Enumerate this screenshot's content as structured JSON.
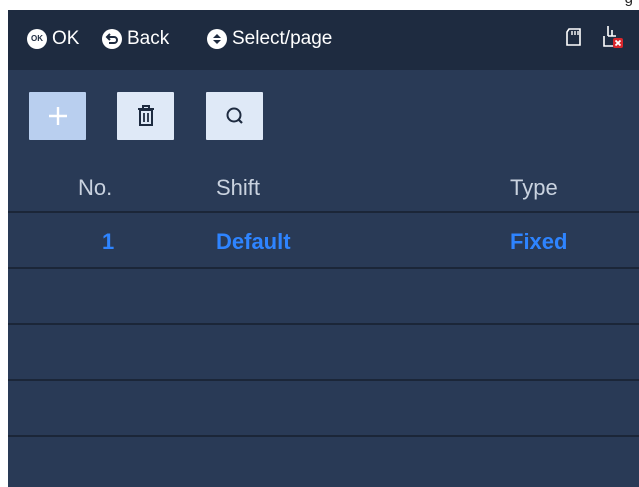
{
  "page_fragment": "g",
  "status": {
    "ok_label": "OK",
    "back_label": "Back",
    "select_label": "Select/page",
    "icons": [
      "ok-icon",
      "back-icon",
      "select-icon",
      "sd-card-icon",
      "network-disconnected-icon"
    ]
  },
  "toolbar": {
    "add_button": "add",
    "delete_button": "delete",
    "search_button": "search"
  },
  "table": {
    "headers": {
      "no": "No.",
      "shift": "Shift",
      "type": "Type"
    },
    "rows": [
      {
        "no": "1",
        "shift": "Default",
        "type": "Fixed"
      }
    ]
  },
  "colors": {
    "background": "#293a56",
    "status_bar": "#1e2b40",
    "accent_text": "#2e84ff",
    "header_text": "#c9d2df",
    "button_bg": "#dfe9f7",
    "button_active": "#b9cfef"
  }
}
